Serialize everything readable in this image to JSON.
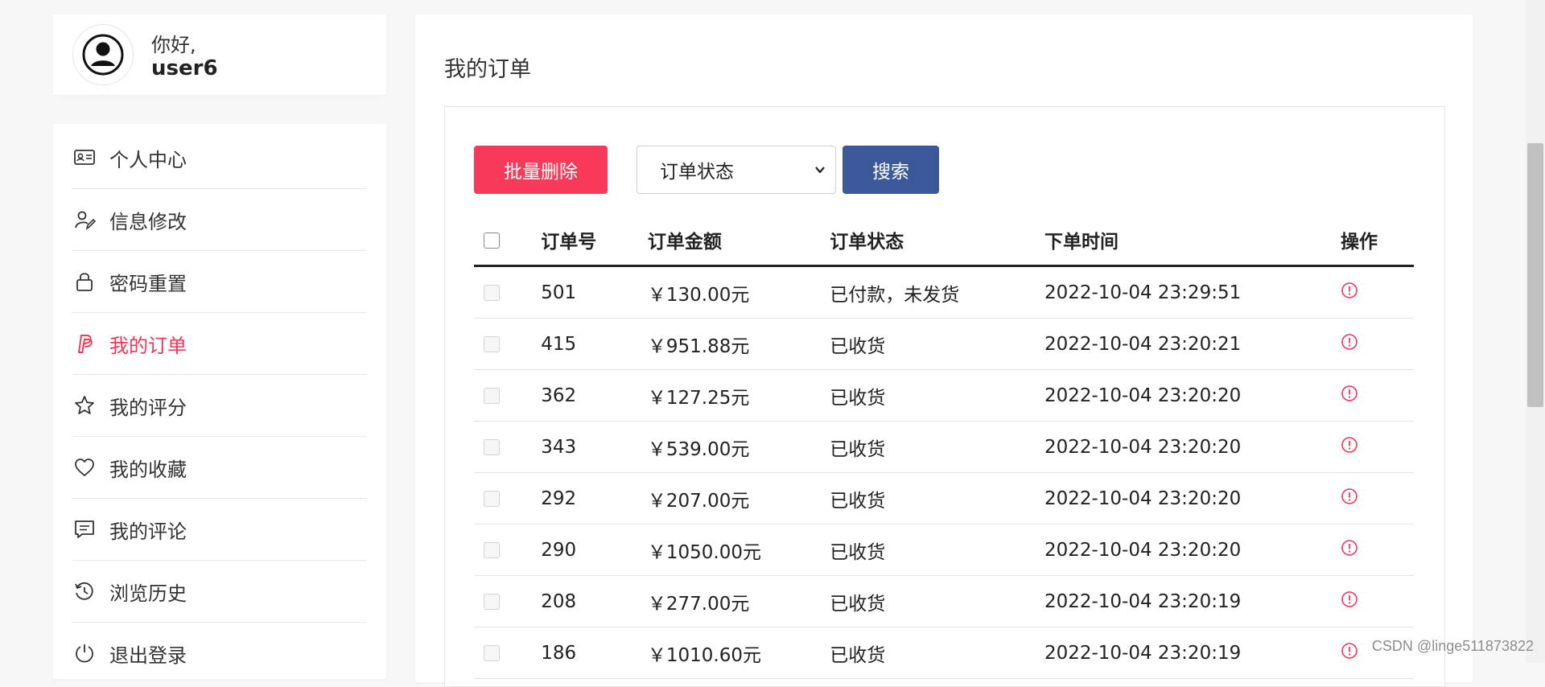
{
  "user": {
    "greeting": "你好,",
    "name": "user6"
  },
  "sidebar": {
    "items": [
      {
        "label": "个人中心",
        "icon": "id-card-icon"
      },
      {
        "label": "信息修改",
        "icon": "user-edit-icon"
      },
      {
        "label": "密码重置",
        "icon": "lock-icon"
      },
      {
        "label": "我的订单",
        "icon": "paypal-icon"
      },
      {
        "label": "我的评分",
        "icon": "star-icon"
      },
      {
        "label": "我的收藏",
        "icon": "heart-icon"
      },
      {
        "label": "我的评论",
        "icon": "comment-icon"
      },
      {
        "label": "浏览历史",
        "icon": "history-icon"
      },
      {
        "label": "退出登录",
        "icon": "power-icon"
      }
    ],
    "active_index": 3
  },
  "main": {
    "title": "我的订单",
    "toolbar": {
      "delete_label": "批量删除",
      "select_label": "订单状态",
      "search_label": "搜索"
    },
    "table": {
      "headers": [
        "订单号",
        "订单金额",
        "订单状态",
        "下单时间",
        "操作"
      ],
      "rows": [
        {
          "id": "501",
          "amount": "￥130.00元",
          "status": "已付款，未发货",
          "time": "2022-10-04 23:29:51"
        },
        {
          "id": "415",
          "amount": "￥951.88元",
          "status": "已收货",
          "time": "2022-10-04 23:20:21"
        },
        {
          "id": "362",
          "amount": "￥127.25元",
          "status": "已收货",
          "time": "2022-10-04 23:20:20"
        },
        {
          "id": "343",
          "amount": "￥539.00元",
          "status": "已收货",
          "time": "2022-10-04 23:20:20"
        },
        {
          "id": "292",
          "amount": "￥207.00元",
          "status": "已收货",
          "time": "2022-10-04 23:20:20"
        },
        {
          "id": "290",
          "amount": "￥1050.00元",
          "status": "已收货",
          "time": "2022-10-04 23:20:20"
        },
        {
          "id": "208",
          "amount": "￥277.00元",
          "status": "已收货",
          "time": "2022-10-04 23:20:19"
        },
        {
          "id": "186",
          "amount": "￥1010.60元",
          "status": "已收货",
          "time": "2022-10-04 23:20:19"
        }
      ],
      "action_icon": "info-circle-icon"
    }
  },
  "watermark": "CSDN @linge511873822",
  "colors": {
    "accent_red": "#f0375a",
    "search_blue": "#3b5998",
    "text": "#222222"
  }
}
